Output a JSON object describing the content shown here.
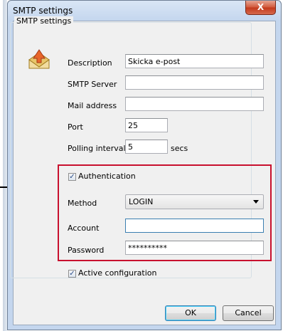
{
  "window": {
    "title": "SMTP settings",
    "close_glyph": "X"
  },
  "group": {
    "legend": "SMTP settings"
  },
  "fields": {
    "description": {
      "label": "Description",
      "value": "Skicka e-post"
    },
    "smtp_server": {
      "label": "SMTP Server",
      "value": ""
    },
    "mail_address": {
      "label": "Mail address",
      "value": ""
    },
    "port": {
      "label": "Port",
      "value": "25"
    },
    "polling_interval": {
      "label": "Polling interval",
      "value": "5",
      "unit": "secs"
    }
  },
  "auth": {
    "checkbox_label": "Authentication",
    "checked": true,
    "method_label": "Method",
    "method_value": "LOGIN",
    "account_label": "Account",
    "account_value": "",
    "password_label": "Password",
    "password_value": "**********"
  },
  "active": {
    "label": "Active configuration",
    "checked": true
  },
  "buttons": {
    "ok": "OK",
    "cancel": "Cancel"
  },
  "colors": {
    "highlight_border": "#c8102e",
    "close_button": "#c2391b"
  },
  "icons": {
    "app": "mail-send-icon",
    "checkmark": "✓"
  }
}
